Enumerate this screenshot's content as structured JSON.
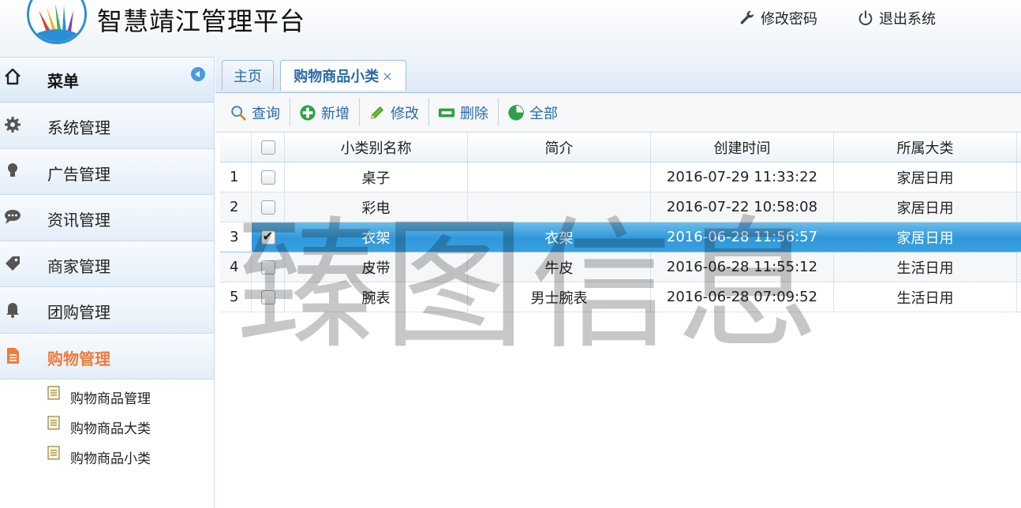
{
  "header": {
    "title": "智慧靖江管理平台",
    "change_password": "修改密码",
    "logout": "退出系统"
  },
  "sidebar": {
    "menu_label": "菜单",
    "items": [
      {
        "label": "系统管理",
        "icon": "gear-icon"
      },
      {
        "label": "广告管理",
        "icon": "bulb-icon"
      },
      {
        "label": "资讯管理",
        "icon": "chat-icon"
      },
      {
        "label": "商家管理",
        "icon": "tag-icon"
      },
      {
        "label": "团购管理",
        "icon": "bell-icon"
      },
      {
        "label": "购物管理",
        "icon": "document-icon",
        "active": true
      }
    ],
    "sub_items": [
      "购物商品管理",
      "购物商品大类",
      "购物商品小类"
    ]
  },
  "tabs": [
    {
      "label": "主页"
    },
    {
      "label": "购物商品小类",
      "close": "×",
      "active": true
    }
  ],
  "toolbar": {
    "search": "查询",
    "add": "新增",
    "edit": "修改",
    "delete": "删除",
    "all": "全部"
  },
  "grid": {
    "columns": [
      "小类别名称",
      "简介",
      "创建时间",
      "所属大类"
    ],
    "rows": [
      {
        "num": "1",
        "name": "桌子",
        "desc": "",
        "created": "2016-07-29 11:33:22",
        "category": "家居日用",
        "checked": false
      },
      {
        "num": "2",
        "name": "彩电",
        "desc": "",
        "created": "2016-07-22 10:58:08",
        "category": "家居日用",
        "checked": false
      },
      {
        "num": "3",
        "name": "衣架",
        "desc": "衣架",
        "created": "2016-06-28 11:56:57",
        "category": "家居日用",
        "checked": true,
        "selected": true
      },
      {
        "num": "4",
        "name": "皮带",
        "desc": "牛皮",
        "created": "2016-06-28 11:55:12",
        "category": "生活日用",
        "checked": false
      },
      {
        "num": "5",
        "name": "腕表",
        "desc": "男士腕表",
        "created": "2016-06-28 07:09:52",
        "category": "生活日用",
        "checked": false
      }
    ]
  },
  "watermark": "臻图信息",
  "colors": {
    "accent": "#2a6aa8",
    "active_menu": "#f07a3c",
    "selected_row": "#3aa0de"
  }
}
